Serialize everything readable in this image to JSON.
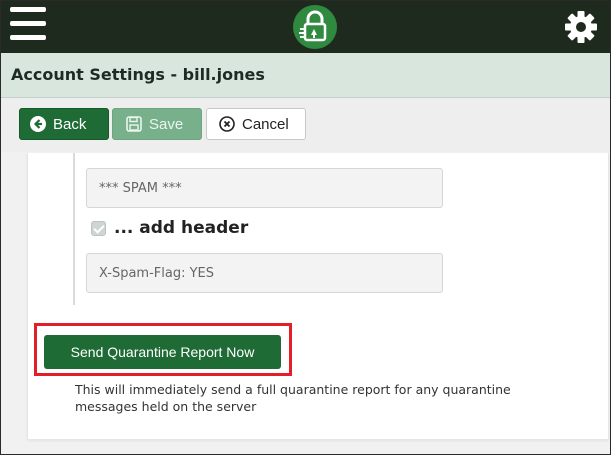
{
  "header": {
    "menu_icon": "hamburger-icon",
    "logo_icon": "lock-logo-icon",
    "settings_icon": "gear-icon"
  },
  "title": "Account Settings - bill.jones",
  "toolbar": {
    "back_label": "Back",
    "save_label": "Save",
    "cancel_label": "Cancel"
  },
  "form": {
    "subject_tag_value": "*** SPAM ***",
    "add_header_label": "... add header",
    "add_header_checked": true,
    "header_value": "X-Spam-Flag: YES"
  },
  "quarantine": {
    "button_label": "Send Quarantine Report Now",
    "description": "This will immediately send a full quarantine report for any quarantine messages held on the server"
  },
  "colors": {
    "topbar": "#1f2a1f",
    "titlebar": "#d8e6de",
    "primary_green": "#1e6b35",
    "highlight_red": "#e21f26"
  }
}
